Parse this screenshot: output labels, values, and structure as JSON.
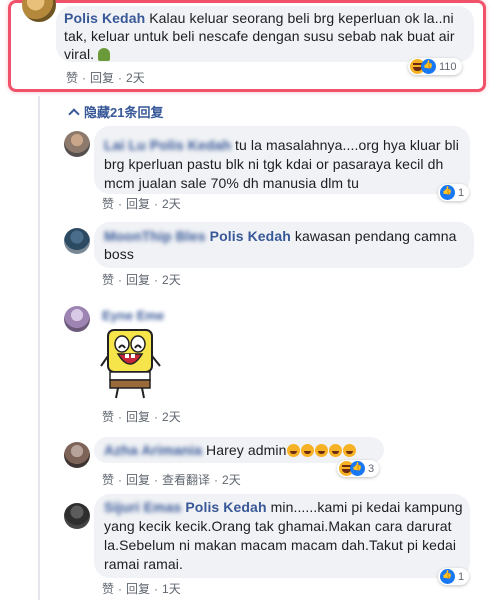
{
  "top_comment": {
    "author": "Polis Kedah",
    "text": "Kalau keluar seorang beli brg keperluan ok la..ni tak, keluar untuk beli nescafe dengan susu sebab nak buat air viral.",
    "like": "赞",
    "reply": "回复",
    "time": "2天",
    "reaction_count": "110"
  },
  "hidden_replies_label": "隐藏21条回复",
  "replies": [
    {
      "author_blurred": "Lai Lu Polis Kedah",
      "text": "tu la masalahnya....org hya kluar bli brg kperluan pastu blk ni tgk kdai or pasaraya kecil dh mcm jualan sale 70% dh manusia dlm tu",
      "like": "赞",
      "reply": "回复",
      "time": "2天",
      "reaction_count": "1"
    },
    {
      "author_blurred": "MoonThip Bles",
      "mention": "Polis Kedah",
      "text": "kawasan pendang camna boss",
      "like": "赞",
      "reply": "回复",
      "time": "2天"
    },
    {
      "author_blurred": "Eyne Eme",
      "sticker": "spongebob-laughing",
      "like": "赞",
      "reply": "回复",
      "time": "2天"
    },
    {
      "author_blurred": "Azha Arimania",
      "text": "Harey admin",
      "like": "赞",
      "reply": "回复",
      "translate": "查看翻译",
      "time": "2天",
      "reaction_count": "3"
    },
    {
      "author_blurred": "Sijuri Emas",
      "mention": "Polis Kedah",
      "text": "min......kami pi kedai kampung yang kecik kecik.Orang tak ghamai.Makan cara darurat la.Sebelum ni makan macam macam dah.Takut pi kedai ramai ramai.",
      "like": "赞",
      "reply": "回复",
      "time": "1天",
      "reaction_count": "1"
    }
  ],
  "colors": {
    "highlight_border": "#f0526a",
    "link": "#385898",
    "bubble": "#f0f2f5"
  }
}
